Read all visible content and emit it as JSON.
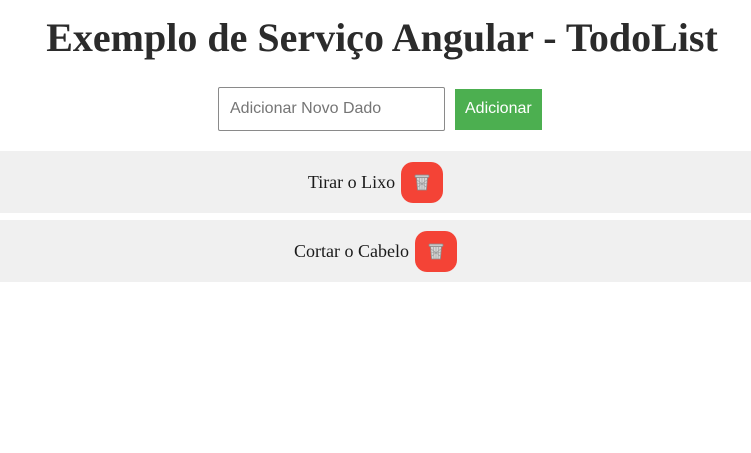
{
  "page": {
    "title": "Exemplo de Serviço Angular - TodoList"
  },
  "add_form": {
    "input_placeholder": "Adicionar Novo Dado",
    "input_value": "",
    "button_label": "Adicionar"
  },
  "todos": [
    {
      "text": "Tirar o Lixo",
      "delete_icon": "wastebasket-icon"
    },
    {
      "text": "Cortar o Cabelo",
      "delete_icon": "wastebasket-icon"
    }
  ],
  "colors": {
    "add_button": "#4caf50",
    "delete_button": "#f44336",
    "row_background": "#f0f0f0"
  }
}
